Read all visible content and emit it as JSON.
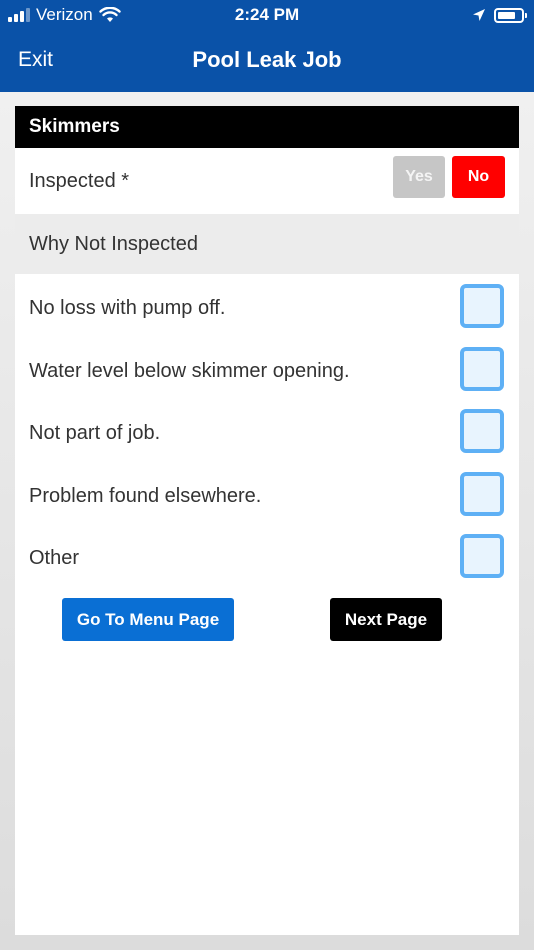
{
  "status_bar": {
    "carrier": "Verizon",
    "time": "2:24 PM",
    "icons": [
      "signal-icon",
      "wifi-icon",
      "location-arrow-icon",
      "battery-icon"
    ]
  },
  "nav": {
    "exit_label": "Exit",
    "title": "Pool Leak Job"
  },
  "section": {
    "title": "Skimmers"
  },
  "inspected": {
    "label": "Inspected *",
    "yes_label": "Yes",
    "no_label": "No",
    "selected": "No"
  },
  "why_not": {
    "heading": "Why Not Inspected",
    "options": [
      {
        "label": "No loss with pump off.",
        "checked": false
      },
      {
        "label": "Water level below skimmer opening.",
        "checked": false
      },
      {
        "label": "Not part of job.",
        "checked": false
      },
      {
        "label": "Problem found elsewhere.",
        "checked": false
      },
      {
        "label": "Other",
        "checked": false
      }
    ]
  },
  "buttons": {
    "menu_label": "Go To Menu Page",
    "next_label": "Next Page"
  },
  "colors": {
    "header_blue": "#0a52a8",
    "no_red": "#ff0000",
    "yes_gray": "#c6c6c6",
    "checkbox_blue": "#5eb0f5",
    "menu_button_blue": "#0a6fd4",
    "next_button_black": "#000000"
  }
}
